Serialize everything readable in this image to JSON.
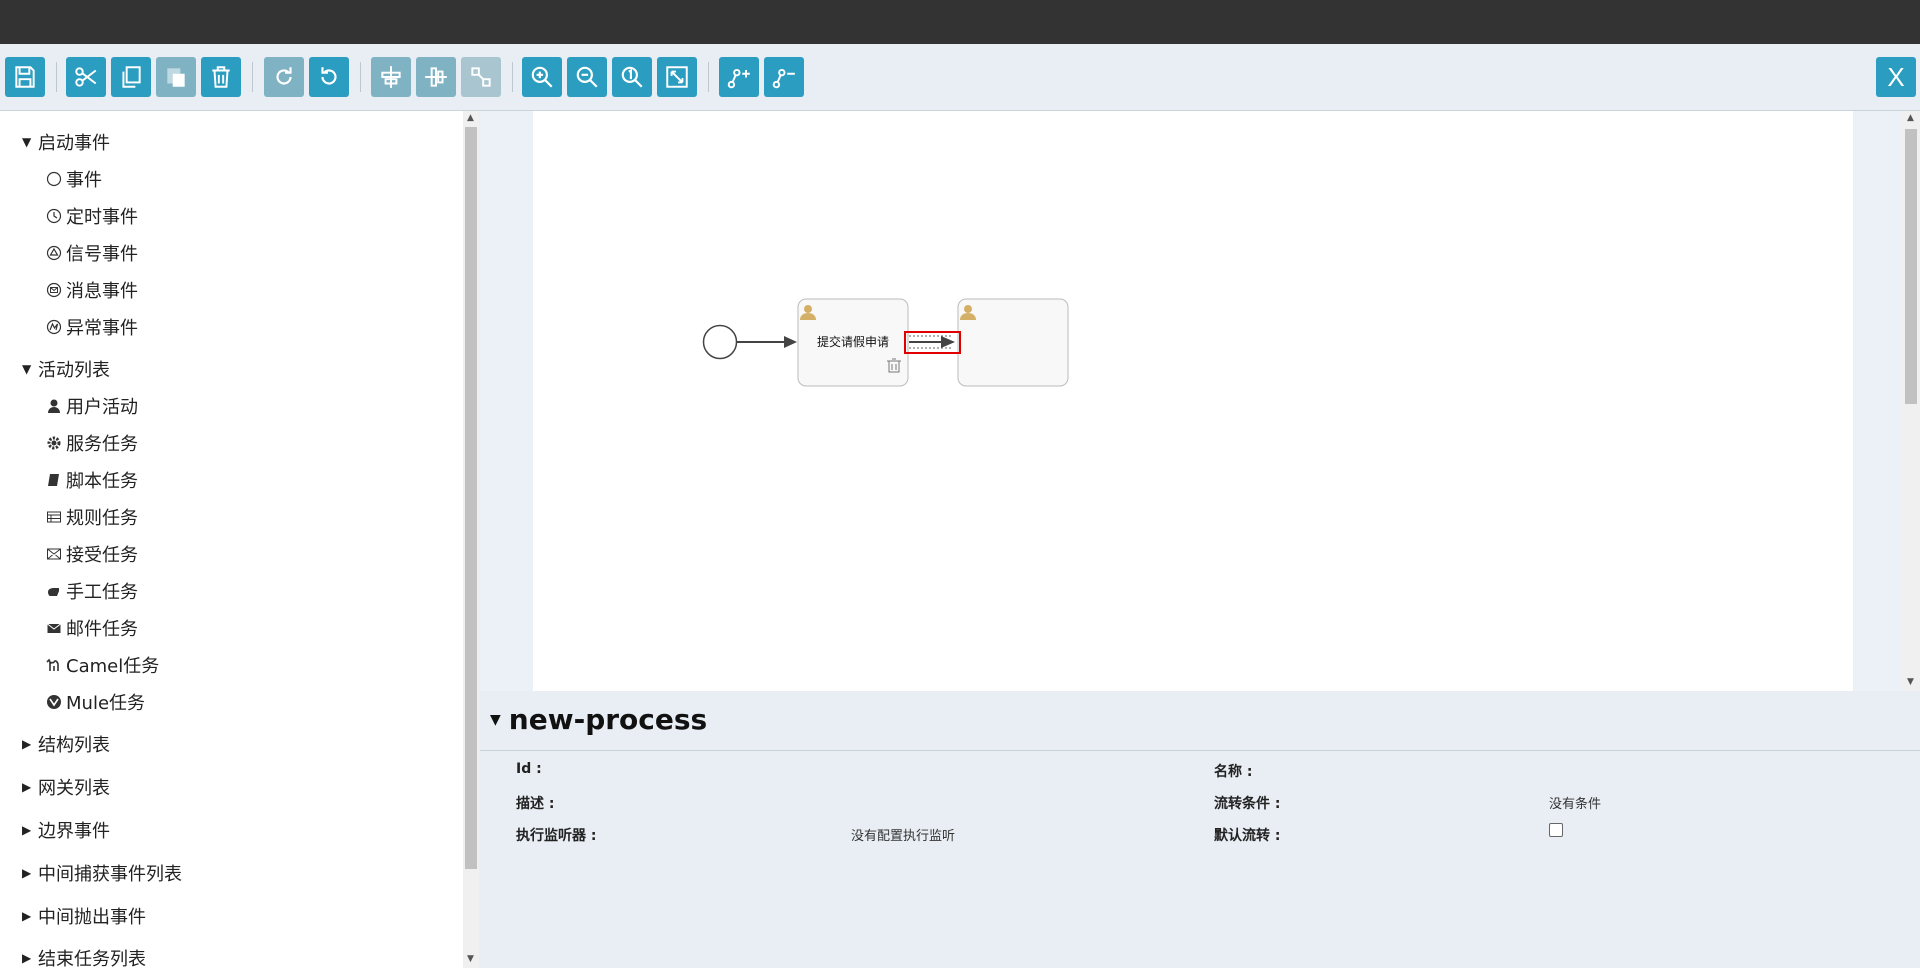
{
  "toolbar": {
    "buttons": [
      "save-icon",
      "cut-icon",
      "copy-icon",
      "paste-icon",
      "delete-icon",
      "redo-icon",
      "undo-icon",
      "align-horizontal-icon",
      "align-vertical-icon",
      "same-size-icon",
      "zoom-in-icon",
      "zoom-out-icon",
      "zoom-actual-icon",
      "zoom-fit-icon",
      "add-bendpoint-icon",
      "remove-bendpoint-icon"
    ],
    "close_label": "X"
  },
  "palette": {
    "groups": [
      {
        "label": "启动事件",
        "expanded": true,
        "items": [
          {
            "label": "事件",
            "icon": "circle-icon"
          },
          {
            "label": "定时事件",
            "icon": "timer-icon"
          },
          {
            "label": "信号事件",
            "icon": "signal-icon"
          },
          {
            "label": "消息事件",
            "icon": "message-icon"
          },
          {
            "label": "异常事件",
            "icon": "error-icon"
          }
        ]
      },
      {
        "label": "活动列表",
        "expanded": true,
        "items": [
          {
            "label": "用户活动",
            "icon": "user-icon"
          },
          {
            "label": "服务任务",
            "icon": "gear-icon"
          },
          {
            "label": "脚本任务",
            "icon": "script-icon"
          },
          {
            "label": "规则任务",
            "icon": "table-icon"
          },
          {
            "label": "接受任务",
            "icon": "receive-icon"
          },
          {
            "label": "手工任务",
            "icon": "hand-icon"
          },
          {
            "label": "邮件任务",
            "icon": "mail-icon"
          },
          {
            "label": "Camel任务",
            "icon": "camel-icon"
          },
          {
            "label": "Mule任务",
            "icon": "mule-icon"
          }
        ]
      },
      {
        "label": "结构列表",
        "expanded": false,
        "items": []
      },
      {
        "label": "网关列表",
        "expanded": false,
        "items": []
      },
      {
        "label": "边界事件",
        "expanded": false,
        "items": []
      },
      {
        "label": "中间捕获事件列表",
        "expanded": false,
        "items": []
      },
      {
        "label": "中间抛出事件",
        "expanded": false,
        "items": []
      },
      {
        "label": "结束任务列表",
        "expanded": false,
        "items": []
      }
    ]
  },
  "diagram": {
    "task1_label": "提交请假申请",
    "task2_label": ""
  },
  "properties": {
    "title": "new-process",
    "id_label": "Id :",
    "id_value": "",
    "name_label": "名称 :",
    "name_value": "",
    "desc_label": "描述 :",
    "desc_value": "",
    "condition_label": "流转条件 :",
    "condition_value": "没有条件",
    "listener_label": "执行监听器 :",
    "listener_value": "没有配置执行监听",
    "default_flow_label": "默认流转 :",
    "default_flow_checked": false
  },
  "colors": {
    "button": "#2a9dc0",
    "button_disabled": "#7fb3c4",
    "selection": "#e00000"
  }
}
